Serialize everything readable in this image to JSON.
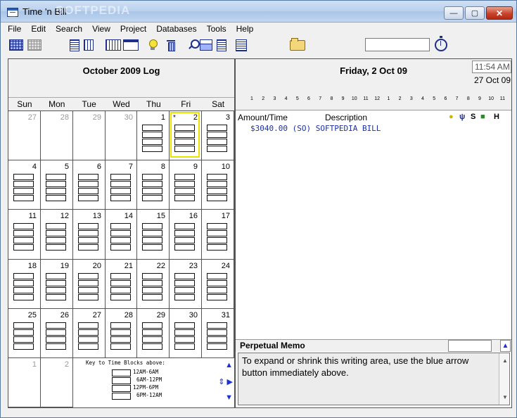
{
  "window": {
    "title": "Time 'n Bill",
    "watermark": "SOFTPEDIA",
    "min_label": "—",
    "max_label": "▢",
    "close_label": "✕"
  },
  "menu": [
    "File",
    "Edit",
    "Search",
    "View",
    "Project",
    "Databases",
    "Tools",
    "Help"
  ],
  "toolbar": {
    "icons": [
      "month-grid-icon",
      "month-grid-gray-icon",
      "timesheet-icon",
      "bars-icon",
      "week-icon",
      "day-icon",
      "bulb-icon",
      "trash-icon",
      "find-icon",
      "print-icon",
      "document-icon",
      "calendar-icon",
      "folder-icon",
      "stopwatch-icon"
    ],
    "search_value": ""
  },
  "calendar": {
    "title": "October 2009 Log",
    "weekdays": [
      "Sun",
      "Mon",
      "Tue",
      "Wed",
      "Thu",
      "Fri",
      "Sat"
    ],
    "weeks": [
      [
        {
          "n": "27",
          "other": true
        },
        {
          "n": "28",
          "other": true
        },
        {
          "n": "29",
          "other": true
        },
        {
          "n": "30",
          "other": true
        },
        {
          "n": "1"
        },
        {
          "n": "2",
          "today": true,
          "star": "*"
        },
        {
          "n": "3"
        }
      ],
      [
        {
          "n": "4"
        },
        {
          "n": "5"
        },
        {
          "n": "6"
        },
        {
          "n": "7"
        },
        {
          "n": "8"
        },
        {
          "n": "9"
        },
        {
          "n": "10"
        }
      ],
      [
        {
          "n": "11"
        },
        {
          "n": "12"
        },
        {
          "n": "13"
        },
        {
          "n": "14"
        },
        {
          "n": "15"
        },
        {
          "n": "16"
        },
        {
          "n": "17"
        }
      ],
      [
        {
          "n": "18"
        },
        {
          "n": "19"
        },
        {
          "n": "20"
        },
        {
          "n": "21"
        },
        {
          "n": "22"
        },
        {
          "n": "23"
        },
        {
          "n": "24"
        }
      ],
      [
        {
          "n": "25"
        },
        {
          "n": "26"
        },
        {
          "n": "27"
        },
        {
          "n": "28"
        },
        {
          "n": "29"
        },
        {
          "n": "30"
        },
        {
          "n": "31"
        }
      ],
      [
        {
          "n": "1",
          "other": true
        },
        {
          "n": "2",
          "other": true
        }
      ]
    ],
    "key": {
      "title": "Key to Time Blocks above:",
      "items": [
        "12AM-6AM",
        "6AM-12PM",
        "12PM-6PM",
        "6PM-12AM"
      ],
      "up_arrow": "▲",
      "mid_arrow": "⇕ ▶",
      "down_arrow": "▼"
    }
  },
  "day": {
    "title": "Friday, 2 Oct 09",
    "time": "11:54 AM",
    "date": "27 Oct 09",
    "hours": [
      "1",
      "2",
      "3",
      "4",
      "5",
      "6",
      "7",
      "8",
      "9",
      "10",
      "11",
      "12",
      "1",
      "2",
      "3",
      "4",
      "5",
      "6",
      "7",
      "8",
      "9",
      "10",
      "11"
    ],
    "columns": {
      "amount": "Amount/Time",
      "description": "Description",
      "s_label": "S",
      "h_label": "H"
    },
    "entry": "$3040.00 (SO) SOFTPEDIA BILL"
  },
  "memo": {
    "title": "Perpetual Memo",
    "input_value": "",
    "up_arrow": "▲",
    "text": "To expand or shrink this writing area, use the blue arrow button immediately above."
  }
}
